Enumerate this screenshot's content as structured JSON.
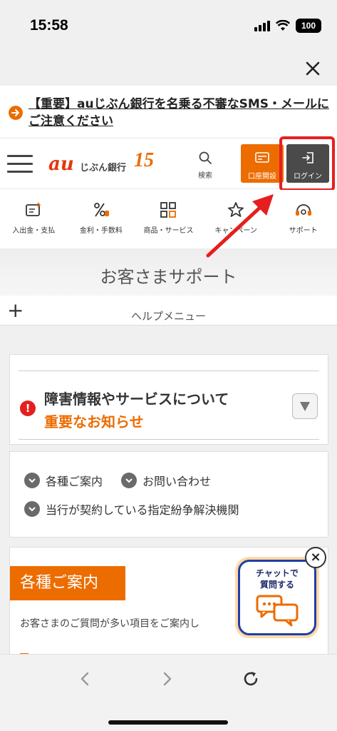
{
  "status": {
    "time": "15:58",
    "battery": "100"
  },
  "notice": {
    "text": "【重要】auじぶん銀行を名乗る不審なSMS・メールにご注意ください"
  },
  "header": {
    "logo_au": "au",
    "logo_bank": "じぶん銀行",
    "logo_anniv": "15",
    "search_label": "検索",
    "open_account_label": "口座開設",
    "login_label": "ログイン"
  },
  "categories": [
    {
      "label": "入出金・支払",
      "icon": "wallet-icon"
    },
    {
      "label": "金利・手数料",
      "icon": "percent-icon"
    },
    {
      "label": "商品・サービス",
      "icon": "grid-icon"
    },
    {
      "label": "キャンペーン",
      "icon": "star-icon"
    },
    {
      "label": "サポート",
      "icon": "support-icon"
    }
  ],
  "page": {
    "title": "お客さまサポート"
  },
  "help": {
    "label": "ヘルプメニュー"
  },
  "alert": {
    "title": "障害情報やサービスについて",
    "subtitle": "重要なお知らせ"
  },
  "links": [
    {
      "label": "各種ご案内"
    },
    {
      "label": "お問い合わせ"
    },
    {
      "label": "当行が契約している指定紛争解決機関"
    }
  ],
  "info": {
    "heading": "各種ご案内",
    "text": "お客さまのご質問が多い項目をご案内し"
  },
  "chat": {
    "line1": "チャットで",
    "line2": "質問する"
  },
  "colors": {
    "brand": "#ec6c00",
    "alert": "#e51f1f",
    "chat_border": "#1f3fa8"
  }
}
